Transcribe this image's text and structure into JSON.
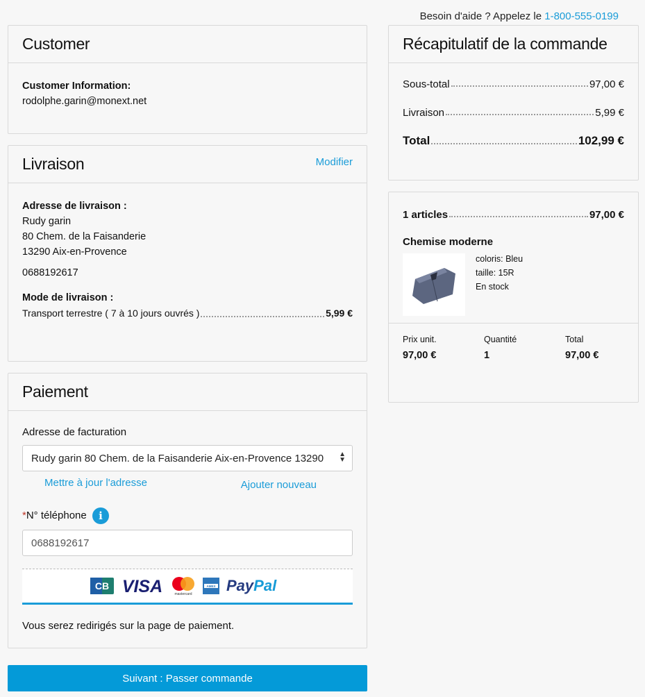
{
  "help": {
    "text": "Besoin d'aide ? Appelez le ",
    "phone": "1-800-555-0199"
  },
  "customer": {
    "title": "Customer",
    "info_label": "Customer Information:",
    "email": "rodolphe.garin@monext.net"
  },
  "livraison": {
    "title": "Livraison",
    "modify": "Modifier",
    "address_label": "Adresse de livraison :",
    "name": "Rudy garin",
    "street": "80 Chem. de la Faisanderie",
    "city": "13290 Aix-en-Provence",
    "phone": "0688192617",
    "mode_label": "Mode de livraison :",
    "mode_name": "Transport terrestre ( 7 à 10 jours ouvrés )",
    "mode_price": "5,99 €"
  },
  "paiement": {
    "title": "Paiement",
    "billing_label": "Adresse de facturation",
    "billing_selected": "Rudy garin 80 Chem. de la Faisanderie Aix-en-Provence 13290",
    "update_link": "Mettre à jour l'adresse",
    "add_link": "Ajouter nouveau",
    "phone_required": "*",
    "phone_label": "N° téléphone",
    "phone_value": "0688192617",
    "logos": [
      "CB",
      "VISA",
      "mastercard",
      "AMERICAN EXPRESS",
      "PayPal"
    ],
    "redirect_note": "Vous serez redirigés sur la page de paiement."
  },
  "summary": {
    "title": "Récapitulatif de la commande",
    "subtotal_label": "Sous-total",
    "subtotal_value": "97,00 €",
    "shipping_label": "Livraison",
    "shipping_value": "5,99 €",
    "total_label": "Total",
    "total_value": "102,99 €"
  },
  "cart": {
    "count_label": "1 articles",
    "count_value": "97,00 €",
    "product_name": "Chemise moderne",
    "color": "coloris: Bleu",
    "size": "taille: 15R",
    "stock": "En stock",
    "unit_label": "Prix unit.",
    "unit_value": "97,00 €",
    "qty_label": "Quantité",
    "qty_value": "1",
    "total_label": "Total",
    "total_value": "97,00 €"
  },
  "cta": {
    "label": "Suivant : Passer commande"
  },
  "colors": {
    "accent": "#1a9cd8",
    "button": "#049ad8"
  }
}
